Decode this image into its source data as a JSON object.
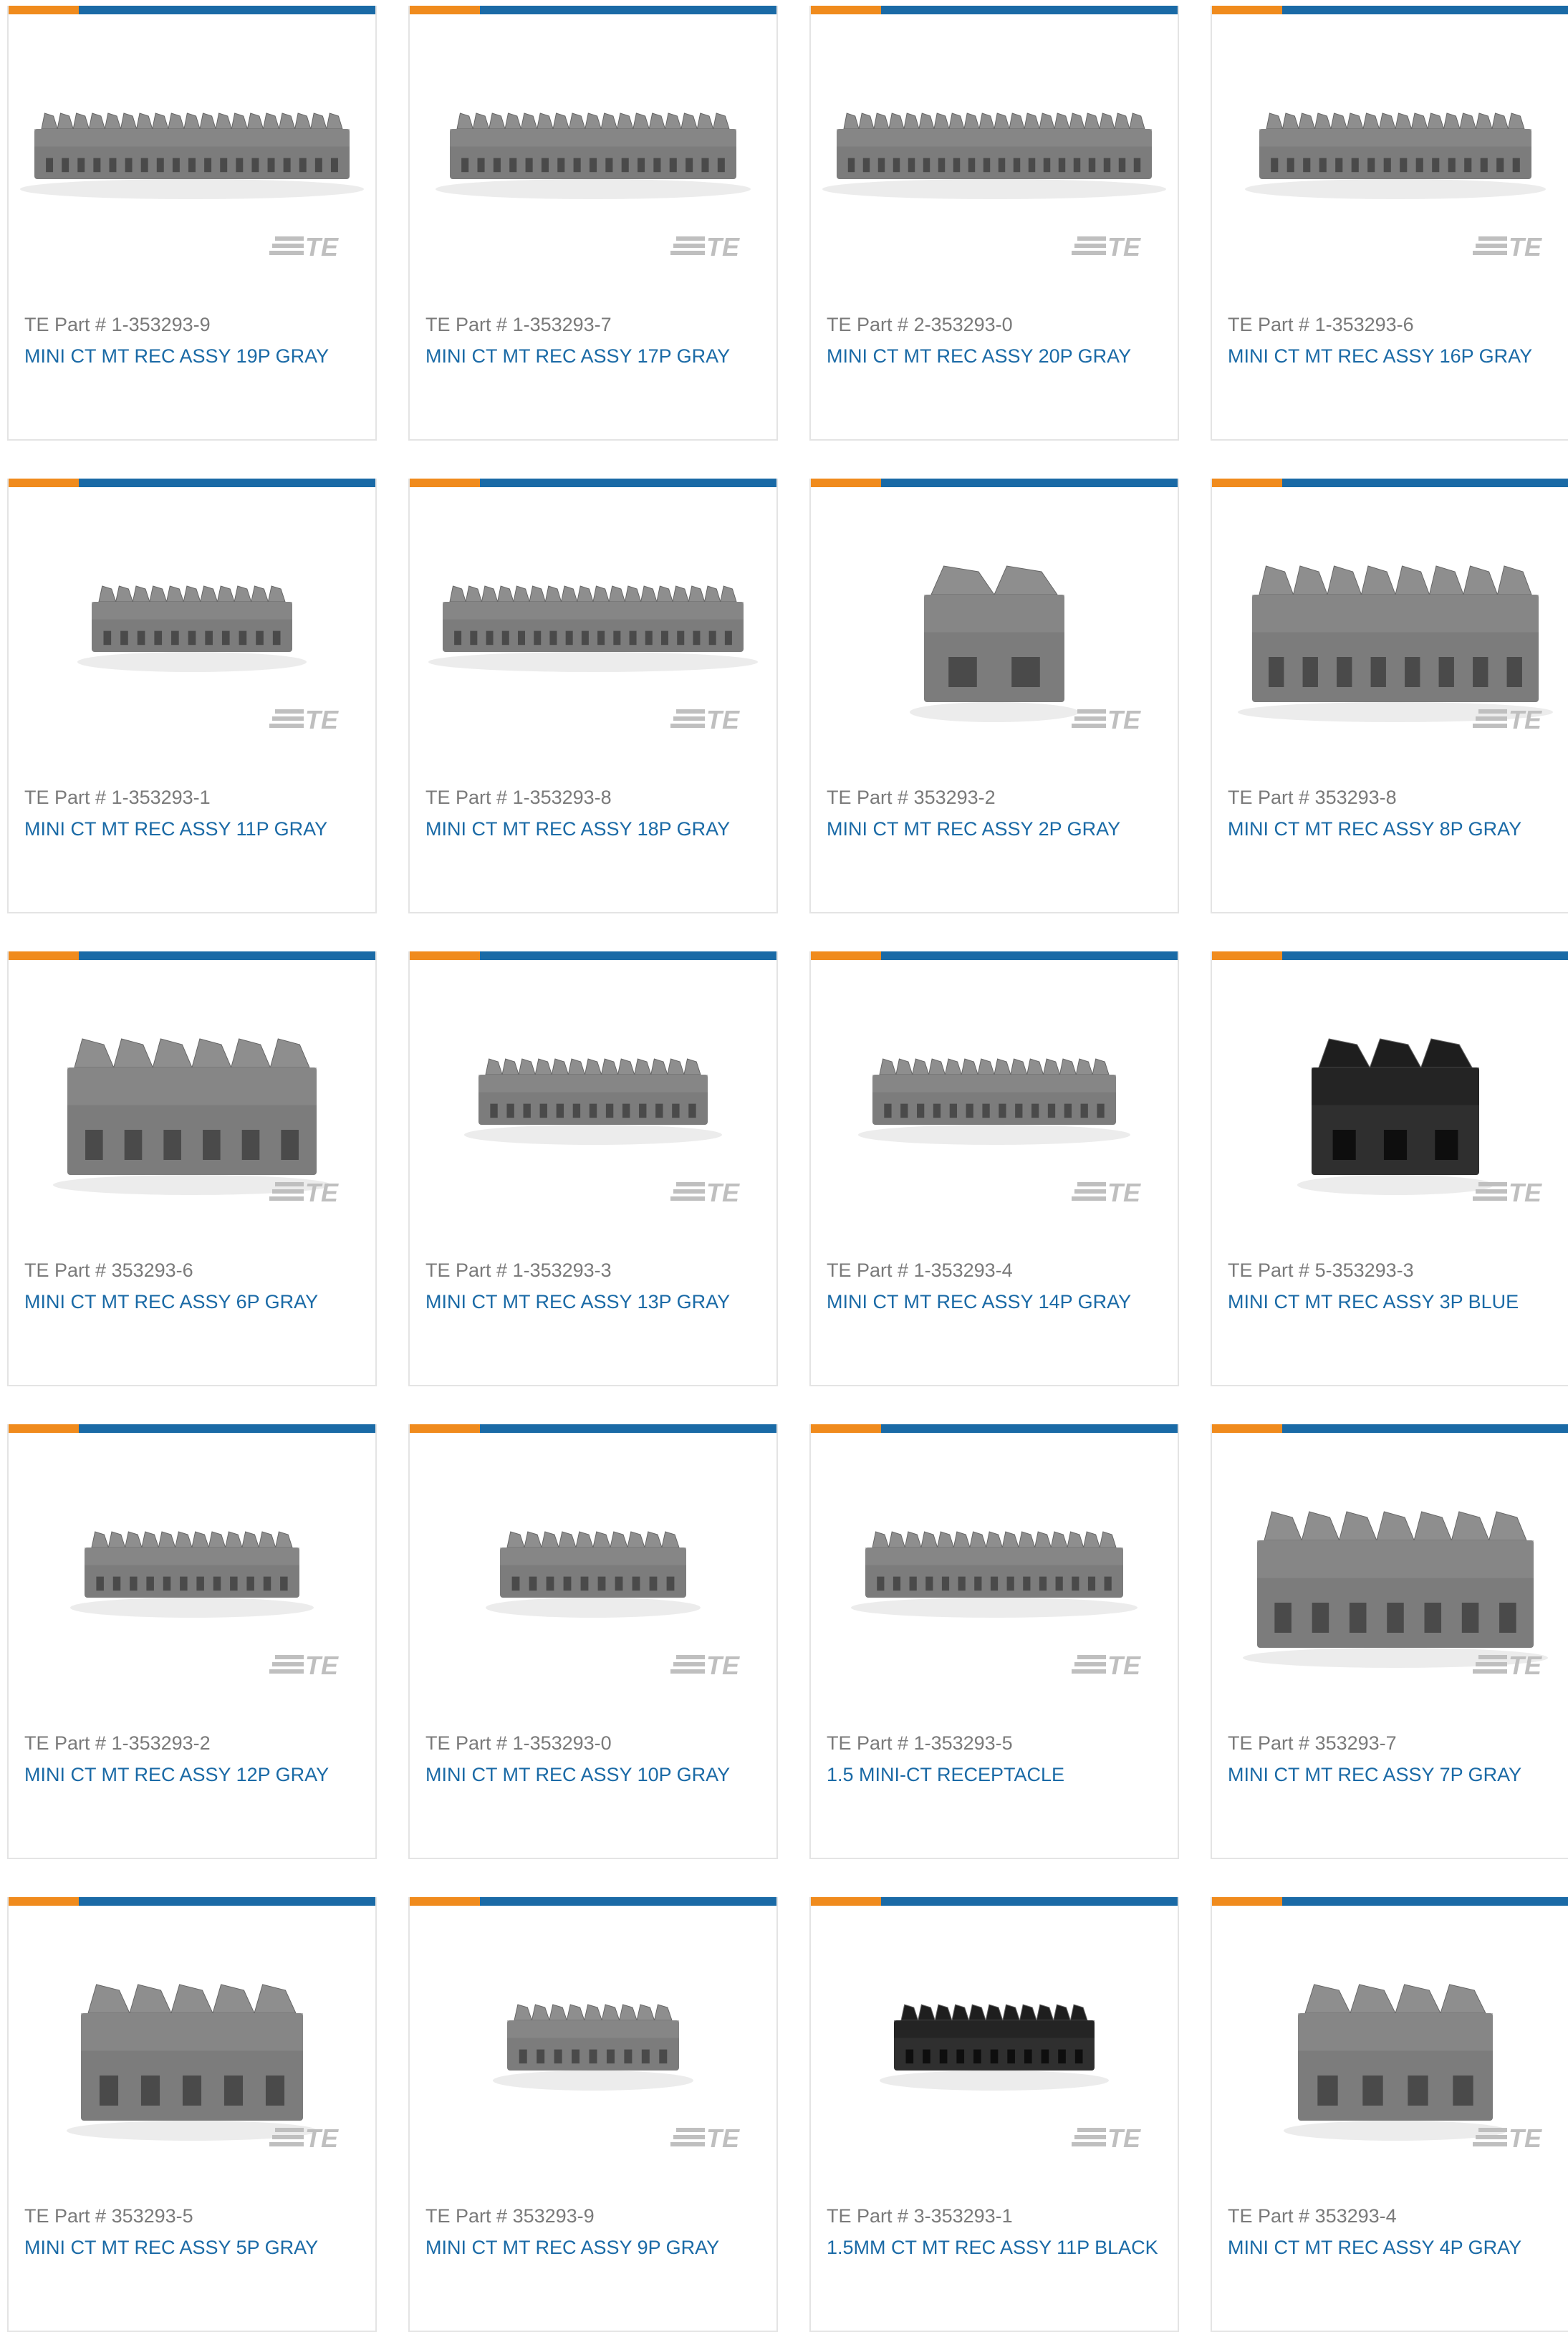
{
  "part_label": "TE Part #",
  "watermark": "TE",
  "colors": {
    "accent_orange": "#f08b1d",
    "accent_blue": "#1a6aa6",
    "connector_gray": "#7c7c7c",
    "connector_black": "#2b2b2b"
  },
  "products": [
    {
      "part_label": "TE Part #",
      "part": "1-353293-9",
      "name": "MINI CT MT REC ASSY 19P GRAY",
      "pins": 19,
      "color": "gray"
    },
    {
      "part_label": "TE Part #",
      "part": "1-353293-7",
      "name": "MINI CT MT REC ASSY 17P GRAY",
      "pins": 17,
      "color": "gray"
    },
    {
      "part_label": "TE Part #",
      "part": "2-353293-0",
      "name": "MINI CT MT REC ASSY 20P GRAY",
      "pins": 20,
      "color": "gray"
    },
    {
      "part_label": "TE Part #",
      "part": "1-353293-6",
      "name": "MINI CT MT REC ASSY 16P GRAY",
      "pins": 16,
      "color": "gray"
    },
    {
      "part_label": "TE Part #",
      "part": "1-353293-1",
      "name": "MINI CT MT REC ASSY 11P GRAY",
      "pins": 11,
      "color": "gray"
    },
    {
      "part_label": "TE Part #",
      "part": "1-353293-8",
      "name": "MINI CT MT REC ASSY 18P GRAY",
      "pins": 18,
      "color": "gray"
    },
    {
      "part_label": "TE Part #",
      "part": "353293-2",
      "name": "MINI CT MT REC ASSY 2P GRAY",
      "pins": 2,
      "color": "gray"
    },
    {
      "part_label": "TE Part #",
      "part": "353293-8",
      "name": "MINI CT MT REC ASSY 8P GRAY",
      "pins": 8,
      "color": "gray"
    },
    {
      "part_label": "TE Part #",
      "part": "353293-6",
      "name": "MINI CT MT REC ASSY 6P GRAY",
      "pins": 6,
      "color": "gray"
    },
    {
      "part_label": "TE Part #",
      "part": "1-353293-3",
      "name": "MINI CT MT REC ASSY 13P GRAY",
      "pins": 13,
      "color": "gray"
    },
    {
      "part_label": "TE Part #",
      "part": "1-353293-4",
      "name": "MINI CT MT REC ASSY 14P GRAY",
      "pins": 14,
      "color": "gray"
    },
    {
      "part_label": "TE Part #",
      "part": "5-353293-3",
      "name": "MINI CT MT REC ASSY 3P BLUE",
      "pins": 3,
      "color": "black"
    },
    {
      "part_label": "TE Part #",
      "part": "1-353293-2",
      "name": "MINI CT MT REC ASSY 12P GRAY",
      "pins": 12,
      "color": "gray"
    },
    {
      "part_label": "TE Part #",
      "part": "1-353293-0",
      "name": "MINI CT MT REC ASSY 10P GRAY",
      "pins": 10,
      "color": "gray"
    },
    {
      "part_label": "TE Part #",
      "part": "1-353293-5",
      "name": "1.5 MINI-CT RECEPTACLE",
      "pins": 15,
      "color": "gray"
    },
    {
      "part_label": "TE Part #",
      "part": "353293-7",
      "name": "MINI CT MT REC ASSY 7P GRAY",
      "pins": 7,
      "color": "gray"
    },
    {
      "part_label": "TE Part #",
      "part": "353293-5",
      "name": "MINI CT MT REC ASSY 5P GRAY",
      "pins": 5,
      "color": "gray"
    },
    {
      "part_label": "TE Part #",
      "part": "353293-9",
      "name": "MINI CT MT REC ASSY 9P GRAY",
      "pins": 9,
      "color": "gray"
    },
    {
      "part_label": "TE Part #",
      "part": "3-353293-1",
      "name": "1.5MM CT MT REC ASSY 11P BLACK",
      "pins": 11,
      "color": "black"
    },
    {
      "part_label": "TE Part #",
      "part": "353293-4",
      "name": "MINI CT MT REC ASSY 4P GRAY",
      "pins": 4,
      "color": "gray"
    }
  ]
}
